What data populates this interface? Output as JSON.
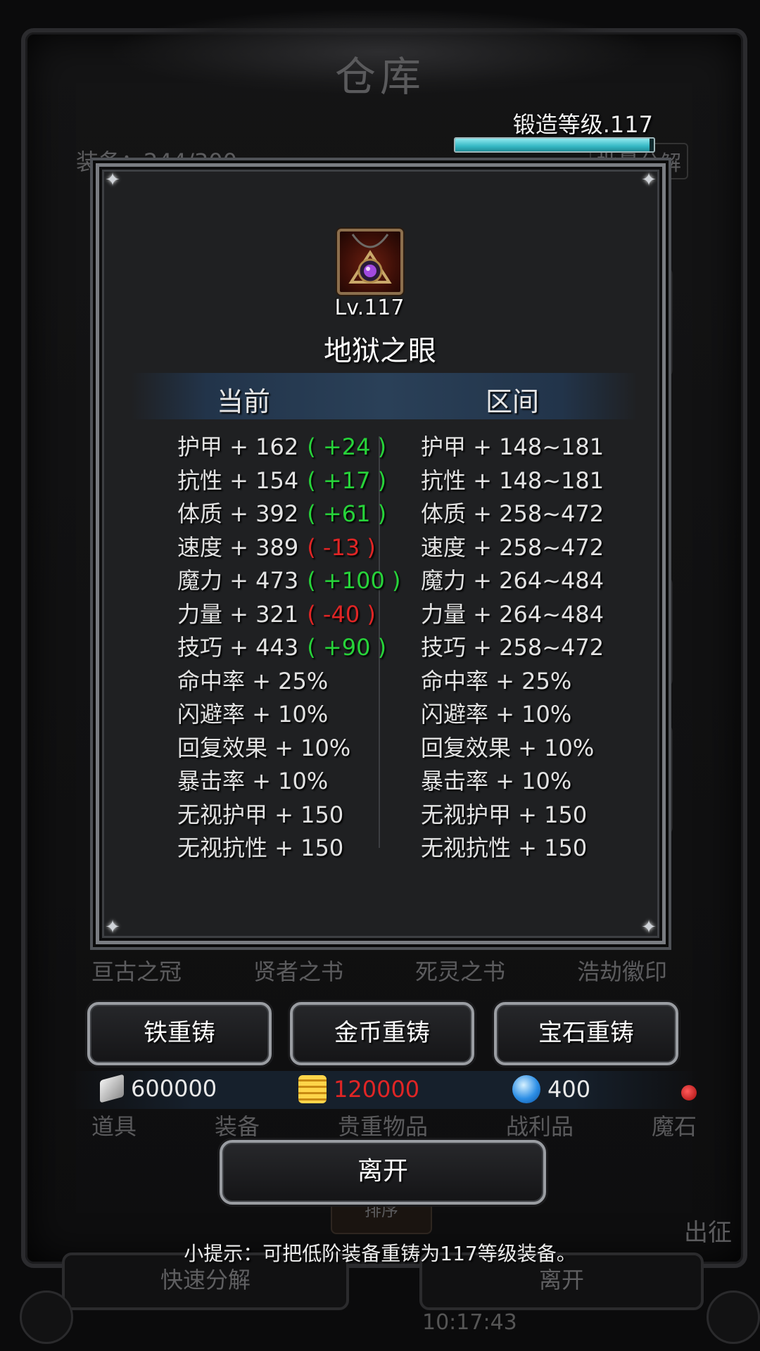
{
  "background": {
    "title": "仓库",
    "equip_count_label": "装备：244/300",
    "batch_button": "批量分解",
    "bg_items": [
      "亘古之冠",
      "贤者之书",
      "死灵之书",
      "浩劫徽印"
    ],
    "tabs": [
      "道具",
      "装备",
      "贵重物品",
      "战利品",
      "魔石"
    ],
    "sort_button": "排序",
    "quick_decompose": "快速分解",
    "leave_bg": "离开",
    "time": "10:17:43",
    "side_label": "出征"
  },
  "forge": {
    "label": "锻造等级.117",
    "progress": 0.98,
    "color": "#35b8c4"
  },
  "item": {
    "level_label": "Lv.117",
    "name": "地狱之眼",
    "icon": "purple-eye-amulet-icon"
  },
  "columns": {
    "current": "当前",
    "range": "区间"
  },
  "current_stats": [
    {
      "text": "护甲 + 162",
      "delta": "( +24 )",
      "sign": "pos"
    },
    {
      "text": "抗性 + 154",
      "delta": "( +17 )",
      "sign": "pos"
    },
    {
      "text": "体质 + 392",
      "delta": "( +61 )",
      "sign": "pos"
    },
    {
      "text": "速度 + 389",
      "delta": "( -13 )",
      "sign": "neg"
    },
    {
      "text": "魔力 + 473",
      "delta": "( +100 )",
      "sign": "pos"
    },
    {
      "text": "力量 + 321",
      "delta": "( -40 )",
      "sign": "neg"
    },
    {
      "text": "技巧 + 443",
      "delta": "( +90 )",
      "sign": "pos"
    },
    {
      "text": "命中率 + 25%",
      "delta": "",
      "sign": ""
    },
    {
      "text": "闪避率 + 10%",
      "delta": "",
      "sign": ""
    },
    {
      "text": "回复效果 + 10%",
      "delta": "",
      "sign": ""
    },
    {
      "text": "暴击率 + 10%",
      "delta": "",
      "sign": ""
    },
    {
      "text": "无视护甲 + 150",
      "delta": "",
      "sign": ""
    },
    {
      "text": "无视抗性 + 150",
      "delta": "",
      "sign": ""
    }
  ],
  "range_stats": [
    "护甲 + 148~181",
    "抗性 + 148~181",
    "体质 + 258~472",
    "速度 + 258~472",
    "魔力 + 264~484",
    "力量 + 264~484",
    "技巧 + 258~472",
    "命中率 + 25%",
    "闪避率 + 10%",
    "回复效果 + 10%",
    "暴击率 + 10%",
    "无视护甲 + 150",
    "无视抗性 + 150"
  ],
  "buttons": {
    "iron_reforge": "铁重铸",
    "gold_reforge": "金币重铸",
    "gem_reforge": "宝石重铸",
    "leave": "离开"
  },
  "resources": {
    "iron": "600000",
    "gold": "120000",
    "gold_color": "#e02525",
    "gems": "400"
  },
  "tip": "小提示：可把低阶装备重铸为117等级装备。"
}
